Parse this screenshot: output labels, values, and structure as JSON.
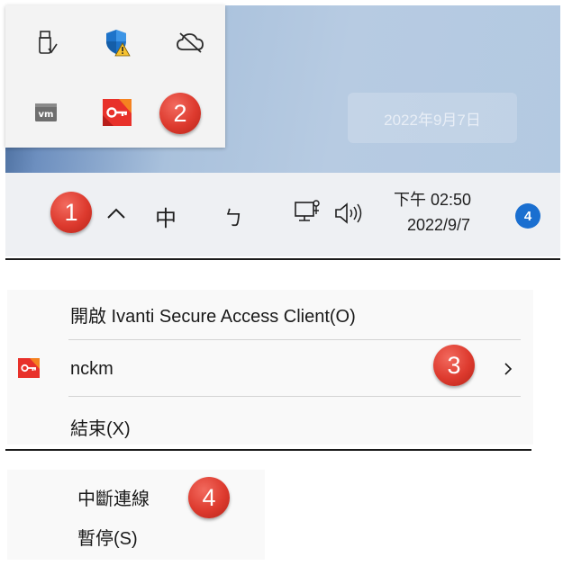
{
  "tray_popup": {
    "icons": [
      "usb-eject-icon",
      "windows-security-warning-icon",
      "onedrive-offline-icon",
      "vmware-icon",
      "ivanti-key-icon"
    ]
  },
  "desktop": {
    "date_tooltip": "2022年9月7日"
  },
  "taskbar": {
    "overflow_chevron": "^",
    "ime_mode": "中",
    "ime_symbol": "ㄅ",
    "clock_time": "下午 02:50",
    "clock_date": "2022/9/7",
    "notification_count": "4"
  },
  "context_menu": {
    "open_item": "開啟 Ivanti Secure Access Client(O)",
    "connection_item": "nckm",
    "exit_item": "結束(X)"
  },
  "submenu": {
    "disconnect_item": "中斷連線",
    "pause_item": "暫停(S)"
  },
  "steps": [
    "1",
    "2",
    "3",
    "4"
  ],
  "colors": {
    "step_marker": "#dd3a2e",
    "notification_badge": "#1a6fd0",
    "ivanti_icon_red": "#e8312a",
    "ivanti_icon_orange": "#f58220"
  }
}
